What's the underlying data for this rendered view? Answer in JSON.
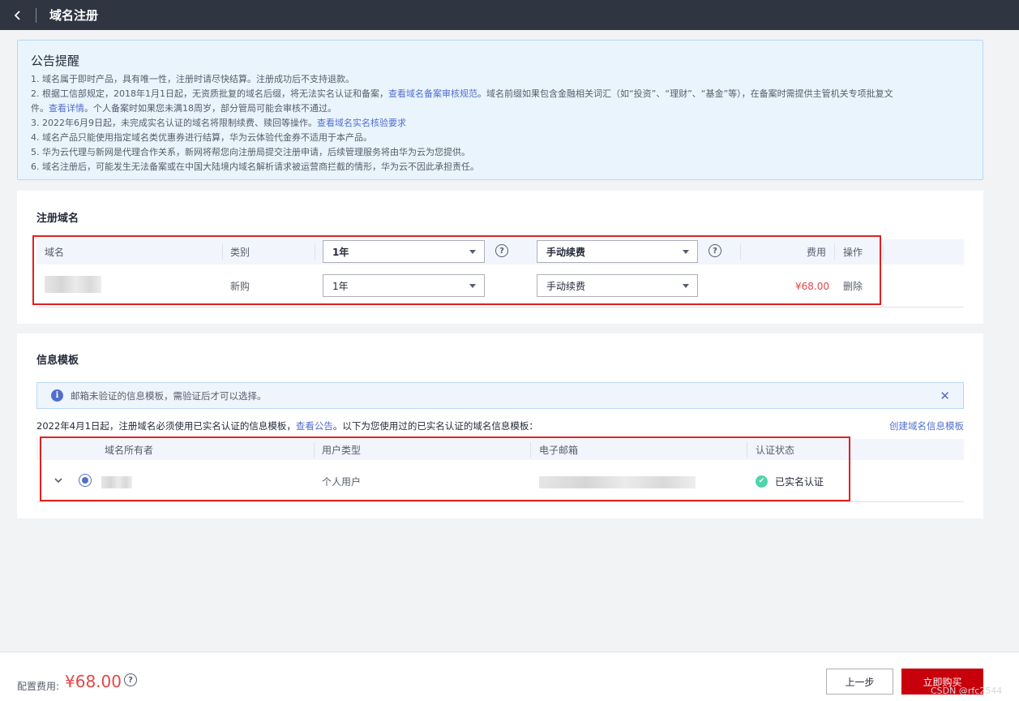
{
  "header": {
    "title": "域名注册"
  },
  "notice": {
    "title": "公告提醒",
    "lines": [
      {
        "text": "1. 域名属于即时产品，具有唯一性，注册时请尽快结算。注册成功后不支持退款。"
      },
      {
        "pre": "2. 根据工信部规定，2018年1月1日起，无资质批复的域名后缀，将无法实名认证和备案，",
        "link": "查看域名备案审核规范",
        "post": "。域名前缀如果包含金融相关词汇（如“投资”、“理财”、“基金”等），在备案时需提供主管机关专项批复文"
      },
      {
        "pre": "件。",
        "link": "查看详情",
        "post": "。个人备案时如果您未满18周岁，部分管局可能会审核不通过。"
      },
      {
        "pre": "3. 2022年6月9日起，未完成实名认证的域名将限制续费、赎回等操作。",
        "link": "查看域名实名核验要求",
        "post": ""
      },
      {
        "text": "4. 域名产品只能使用指定域名类优惠券进行结算，华为云体验代金券不适用于本产品。"
      },
      {
        "text": "5. 华为云代理与新网是代理合作关系，新网将帮您向注册局提交注册申请，后续管理服务将由华为云为您提供。"
      },
      {
        "text": "6. 域名注册后，可能发生无法备案或在中国大陆境内域名解析请求被运营商拦截的情形，华为云不因此承担责任。"
      }
    ]
  },
  "register": {
    "title": "注册域名",
    "headers": {
      "domain": "域名",
      "category": "类别",
      "fee": "费用",
      "action": "操作"
    },
    "header_period": "1年",
    "header_renew": "手动续费",
    "row": {
      "category": "新购",
      "period": "1年",
      "renew": "手动续费",
      "fee": "¥68.00",
      "action": "删除"
    }
  },
  "template": {
    "title": "信息模板",
    "alert": "邮箱未验证的信息模板，需验证后才可以选择。",
    "note_pre": "2022年4月1日起，注册域名必须使用已实名认证的信息模板，",
    "note_link": "查看公告",
    "note_post": "。以下为您使用过的已实名认证的域名信息模板：",
    "create_link": "创建域名信息模板",
    "headers": {
      "owner": "域名所有者",
      "user_type": "用户类型",
      "email": "电子邮箱",
      "status": "认证状态"
    },
    "row": {
      "user_type": "个人用户",
      "status": "已实名认证"
    }
  },
  "footer": {
    "fee_label": "配置费用:",
    "fee_value": "¥68.00",
    "prev": "上一步",
    "buy": "立即购买",
    "watermark": "CSDN @rfc2544"
  },
  "colors": {
    "accent": "#526ecc",
    "price": "#e54545",
    "buy": "#c7000b",
    "highlight": "#e02020"
  },
  "icons": {
    "back": "chevron-left-icon",
    "help": "question-circle-icon",
    "info": "info-circle-icon",
    "close": "close-icon",
    "expand": "chevron-down-icon",
    "verified": "check-circle-icon"
  }
}
